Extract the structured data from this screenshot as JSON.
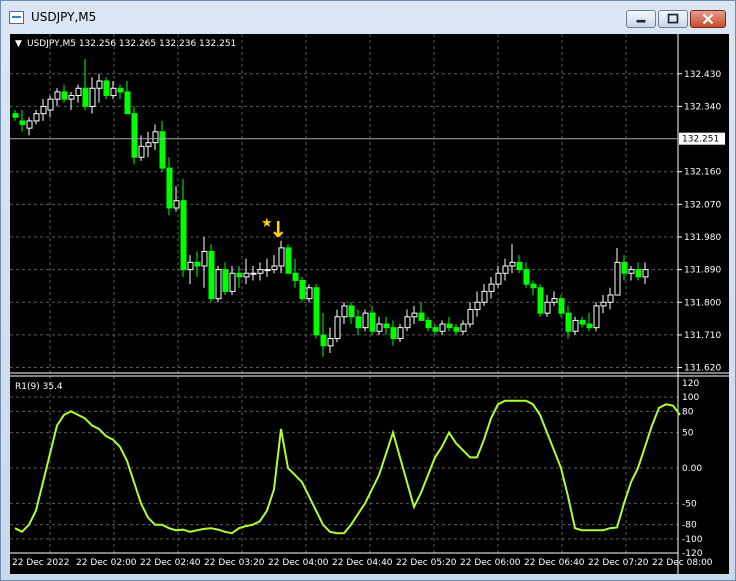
{
  "window": {
    "title": "USDJPY,M5",
    "icon": "chart-window-icon",
    "buttons": [
      "minimize",
      "maximize",
      "close"
    ]
  },
  "chart_header": {
    "menu_glyph": "▼",
    "text": "USDJPY,M5  132.256 132.265 132.236 132.251"
  },
  "price_axis": {
    "labels": [
      "132.430",
      "132.340",
      "132.160",
      "132.070",
      "131.980",
      "131.890",
      "131.800",
      "131.710",
      "131.620"
    ],
    "current_price": "132.251"
  },
  "indicator": {
    "label": "R1(9) 35.4",
    "levels": [
      "120",
      "100",
      "80",
      "50",
      "0.00",
      "-50",
      "-80",
      "-100",
      "-120"
    ]
  },
  "time_axis": {
    "labels": [
      "22 Dec 2022",
      "22 Dec 02:00",
      "22 Dec 02:40",
      "22 Dec 03:20",
      "22 Dec 04:00",
      "22 Dec 04:40",
      "22 Dec 05:20",
      "22 Dec 06:00",
      "22 Dec 06:40",
      "22 Dec 07:20",
      "22 Dec 08:00"
    ]
  },
  "markers": {
    "signal": "sell-arrow",
    "star": "★",
    "arrow": "↓"
  },
  "colors": {
    "background": "#000000",
    "grid": "#5a5a5a",
    "bull_candle": "#ffffff",
    "bear_candle": "#00ff00",
    "indicator_line": "#adff2f",
    "signal_marker": "#ffd700",
    "axis_text": "#ffffff",
    "current_price_bg": "#ffffff"
  },
  "chart_data": {
    "type": "candlestick",
    "symbol": "USDJPY",
    "timeframe": "M5",
    "price_range": [
      131.605,
      132.49
    ],
    "current_price": 132.251,
    "candles": [
      [
        132.32,
        132.33,
        132.3,
        132.31
      ],
      [
        132.3,
        132.33,
        132.27,
        132.29
      ],
      [
        132.28,
        132.31,
        132.26,
        132.3
      ],
      [
        132.3,
        132.33,
        132.29,
        132.32
      ],
      [
        132.32,
        132.36,
        132.3,
        132.34
      ],
      [
        132.33,
        132.37,
        132.31,
        132.36
      ],
      [
        132.36,
        132.39,
        132.34,
        132.38
      ],
      [
        132.38,
        132.4,
        132.35,
        132.36
      ],
      [
        132.36,
        132.38,
        132.33,
        132.37
      ],
      [
        132.37,
        132.4,
        132.35,
        132.39
      ],
      [
        132.39,
        132.47,
        132.33,
        132.34
      ],
      [
        132.34,
        132.42,
        132.32,
        132.39
      ],
      [
        132.39,
        132.43,
        132.35,
        132.41
      ],
      [
        132.41,
        132.42,
        132.36,
        132.37
      ],
      [
        132.37,
        132.41,
        132.36,
        132.39
      ],
      [
        132.39,
        132.4,
        132.36,
        132.38
      ],
      [
        132.38,
        132.41,
        132.32,
        132.32
      ],
      [
        132.32,
        132.34,
        132.18,
        132.2
      ],
      [
        132.2,
        132.26,
        132.19,
        132.23
      ],
      [
        132.23,
        132.27,
        132.2,
        132.24
      ],
      [
        132.24,
        132.29,
        132.22,
        132.27
      ],
      [
        132.27,
        132.3,
        132.16,
        132.17
      ],
      [
        132.17,
        132.2,
        132.04,
        132.06
      ],
      [
        132.06,
        132.12,
        132.05,
        132.08
      ],
      [
        132.08,
        132.14,
        131.87,
        131.89
      ],
      [
        131.89,
        131.93,
        131.85,
        131.91
      ],
      [
        131.91,
        131.94,
        131.87,
        131.9
      ],
      [
        131.9,
        131.98,
        131.84,
        131.94
      ],
      [
        131.94,
        131.96,
        131.8,
        131.81
      ],
      [
        131.81,
        131.9,
        131.8,
        131.89
      ],
      [
        131.89,
        131.91,
        131.82,
        131.83
      ],
      [
        131.83,
        131.9,
        131.82,
        131.88
      ],
      [
        131.88,
        131.9,
        131.84,
        131.87
      ],
      [
        131.87,
        131.92,
        131.85,
        131.88
      ],
      [
        131.88,
        131.9,
        131.86,
        131.88
      ],
      [
        131.88,
        131.91,
        131.86,
        131.89
      ],
      [
        131.89,
        131.92,
        131.87,
        131.89
      ],
      [
        131.89,
        131.93,
        131.88,
        131.9
      ],
      [
        131.9,
        131.97,
        131.88,
        131.95
      ],
      [
        131.95,
        131.96,
        131.88,
        131.88
      ],
      [
        131.88,
        131.92,
        131.84,
        131.86
      ],
      [
        131.86,
        131.87,
        131.8,
        131.81
      ],
      [
        131.81,
        131.85,
        131.8,
        131.84
      ],
      [
        131.84,
        131.85,
        131.7,
        131.71
      ],
      [
        131.71,
        131.77,
        131.65,
        131.68
      ],
      [
        131.68,
        131.73,
        131.66,
        131.7
      ],
      [
        131.7,
        131.78,
        131.69,
        131.76
      ],
      [
        131.76,
        131.8,
        131.74,
        131.79
      ],
      [
        131.79,
        131.8,
        131.74,
        131.76
      ],
      [
        131.76,
        131.78,
        131.71,
        131.73
      ],
      [
        131.73,
        131.78,
        131.72,
        131.77
      ],
      [
        131.77,
        131.79,
        131.71,
        131.72
      ],
      [
        131.72,
        131.76,
        131.71,
        131.74
      ],
      [
        131.74,
        131.76,
        131.71,
        131.73
      ],
      [
        131.73,
        131.75,
        131.68,
        131.7
      ],
      [
        131.7,
        131.74,
        131.69,
        131.73
      ],
      [
        131.73,
        131.78,
        131.72,
        131.76
      ],
      [
        131.76,
        131.79,
        131.74,
        131.77
      ],
      [
        131.77,
        131.8,
        131.75,
        131.75
      ],
      [
        131.75,
        131.76,
        131.72,
        131.73
      ],
      [
        131.73,
        131.74,
        131.71,
        131.72
      ],
      [
        131.72,
        131.75,
        131.71,
        131.74
      ],
      [
        131.74,
        131.76,
        131.72,
        131.73
      ],
      [
        131.73,
        131.74,
        131.71,
        131.72
      ],
      [
        131.72,
        131.75,
        131.71,
        131.74
      ],
      [
        131.74,
        131.8,
        131.73,
        131.78
      ],
      [
        131.78,
        131.83,
        131.76,
        131.8
      ],
      [
        131.8,
        131.85,
        131.79,
        131.83
      ],
      [
        131.83,
        131.87,
        131.81,
        131.85
      ],
      [
        131.85,
        131.9,
        131.84,
        131.88
      ],
      [
        131.88,
        131.92,
        131.86,
        131.9
      ],
      [
        131.9,
        131.96,
        131.88,
        131.91
      ],
      [
        131.91,
        131.93,
        131.88,
        131.89
      ],
      [
        131.89,
        131.91,
        131.84,
        131.85
      ],
      [
        131.85,
        131.86,
        131.82,
        131.84
      ],
      [
        131.84,
        131.85,
        131.76,
        131.77
      ],
      [
        131.77,
        131.82,
        131.76,
        131.8
      ],
      [
        131.8,
        131.83,
        131.79,
        131.81
      ],
      [
        131.81,
        131.82,
        131.76,
        131.77
      ],
      [
        131.77,
        131.79,
        131.7,
        131.72
      ],
      [
        131.72,
        131.76,
        131.71,
        131.75
      ],
      [
        131.75,
        131.76,
        131.73,
        131.74
      ],
      [
        131.74,
        131.77,
        131.72,
        131.73
      ],
      [
        131.73,
        131.8,
        131.72,
        131.79
      ],
      [
        131.79,
        131.82,
        131.77,
        131.8
      ],
      [
        131.8,
        131.84,
        131.78,
        131.82
      ],
      [
        131.82,
        131.95,
        131.83,
        131.91
      ],
      [
        131.91,
        131.93,
        131.86,
        131.88
      ],
      [
        131.88,
        131.9,
        131.86,
        131.89
      ],
      [
        131.89,
        131.91,
        131.86,
        131.87
      ],
      [
        131.87,
        131.91,
        131.85,
        131.89
      ]
    ],
    "indicator": {
      "name": "R1(9)",
      "value": 35.4,
      "range": [
        -120,
        120
      ],
      "levels": [
        120,
        100,
        80,
        50,
        0,
        -50,
        -80,
        -100,
        -120
      ],
      "series": [
        -85,
        -90,
        -80,
        -60,
        -20,
        20,
        60,
        75,
        80,
        75,
        70,
        60,
        55,
        45,
        40,
        30,
        10,
        -20,
        -50,
        -70,
        -80,
        -80,
        -85,
        -88,
        -87,
        -90,
        -88,
        -86,
        -85,
        -87,
        -90,
        -92,
        -85,
        -82,
        -80,
        -75,
        -60,
        -30,
        55,
        0,
        -10,
        -20,
        -40,
        -60,
        -80,
        -90,
        -92,
        -92,
        -80,
        -65,
        -50,
        -30,
        -10,
        20,
        50,
        15,
        -20,
        -55,
        -35,
        -10,
        15,
        30,
        50,
        35,
        25,
        15,
        15,
        40,
        70,
        90,
        95,
        95,
        95,
        95,
        90,
        75,
        50,
        25,
        0,
        -40,
        -85,
        -88,
        -88,
        -88,
        -88,
        -85,
        -84,
        -50,
        -20,
        0,
        30,
        60,
        85,
        90,
        88,
        75
      ]
    }
  }
}
